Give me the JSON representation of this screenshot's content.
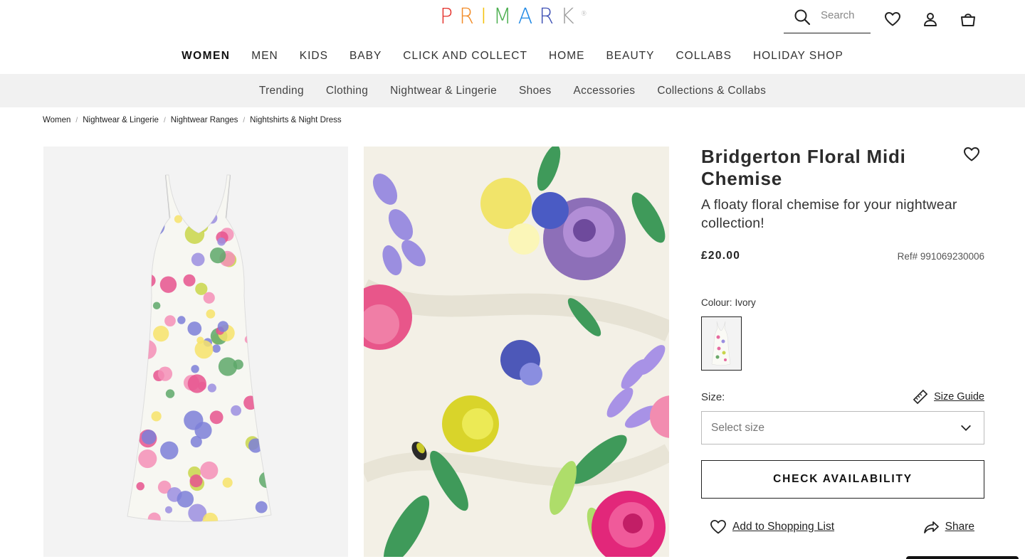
{
  "header": {
    "logo_letters": [
      {
        "ch": "P",
        "color": "#e4312b"
      },
      {
        "ch": "R",
        "color": "#f28c28"
      },
      {
        "ch": "I",
        "color": "#f4c20d"
      },
      {
        "ch": "M",
        "color": "#4caf50"
      },
      {
        "ch": "A",
        "color": "#1e88e5"
      },
      {
        "ch": "R",
        "color": "#3f51b5"
      },
      {
        "ch": "K",
        "color": "#9e9e9e"
      }
    ],
    "logo_mark": "®",
    "search_placeholder": "Search",
    "icons": [
      "search-icon",
      "heart-icon",
      "user-icon",
      "bag-icon"
    ]
  },
  "main_nav": [
    "WOMEN",
    "MEN",
    "KIDS",
    "BABY",
    "CLICK AND COLLECT",
    "HOME",
    "BEAUTY",
    "COLLABS",
    "HOLIDAY SHOP"
  ],
  "main_nav_active": "WOMEN",
  "sub_nav": [
    "Trending",
    "Clothing",
    "Nightwear & Lingerie",
    "Shoes",
    "Accessories",
    "Collections & Collabs"
  ],
  "breadcrumb": [
    "Women",
    "Nightwear & Lingerie",
    "Nightwear Ranges",
    "Nightshirts & Night Dress"
  ],
  "product": {
    "title": "Bridgerton Floral Midi Chemise",
    "description": "A floaty floral chemise for your nightwear collection!",
    "price": "£20.00",
    "ref": "Ref# 991069230006",
    "colour_label": "Colour:",
    "colour_value": "Ivory",
    "size_label": "Size:",
    "size_guide": "Size Guide",
    "size_placeholder": "Select size",
    "check_availability": "CHECK AVAILABILITY",
    "add_to_list": "Add to Shopping List",
    "share": "Share"
  },
  "colors": {
    "subnav_bg": "#f1f1f1",
    "image_bg": "#f3f3f3",
    "text": "#222222"
  }
}
